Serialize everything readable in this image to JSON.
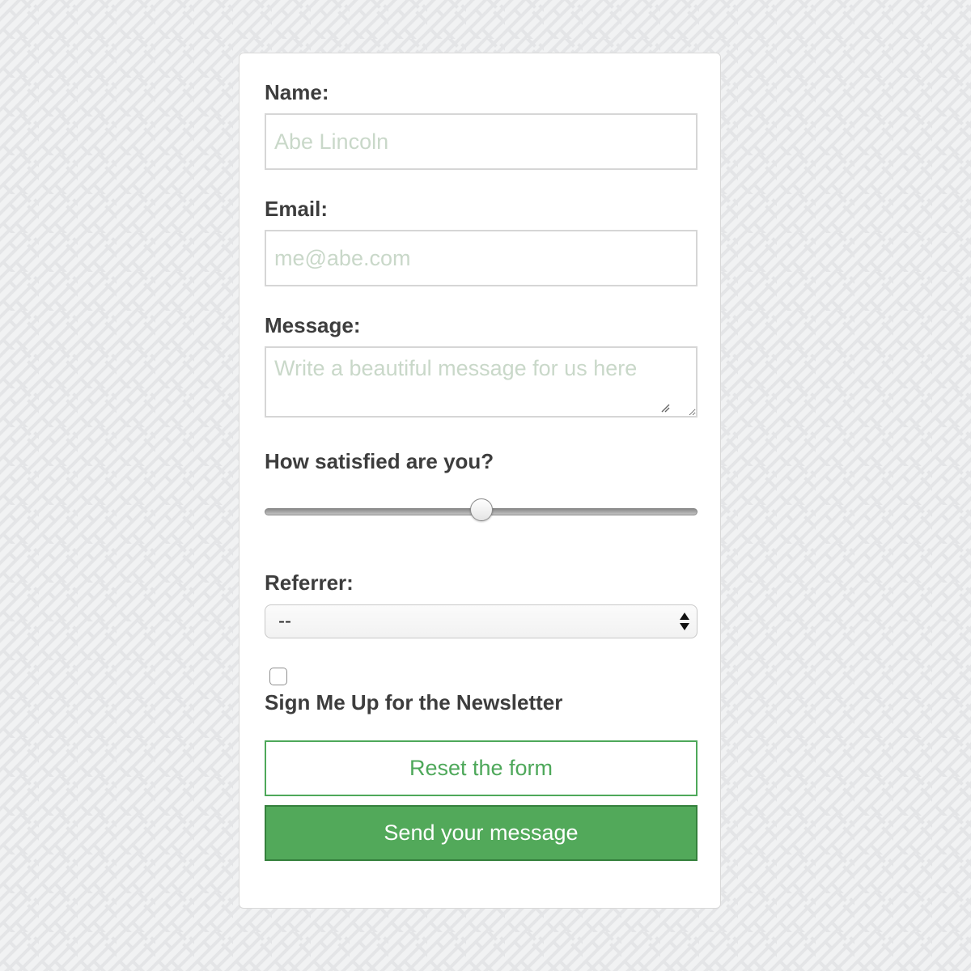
{
  "form": {
    "name_label": "Name:",
    "name_placeholder": "Abe Lincoln",
    "name_value": "",
    "email_label": "Email:",
    "email_placeholder": "me@abe.com",
    "email_value": "",
    "message_label": "Message:",
    "message_placeholder": "Write a beautiful message for us here",
    "message_value": "",
    "satisfaction_label": "How satisfied are you?",
    "satisfaction_value": 0.5,
    "referrer_label": "Referrer:",
    "referrer_selected": "--",
    "newsletter_checked": false,
    "newsletter_label": "Sign Me Up for the Newsletter",
    "reset_label": "Reset the form",
    "send_label": "Send your message"
  },
  "colors": {
    "accent": "#52a95a",
    "accent_border": "#34803c",
    "label_text": "#3d3d3d",
    "placeholder_text": "#c9d8c9",
    "background": "#f1f2f3"
  },
  "icons": {
    "select_arrows": "up-down-arrows-icon",
    "resize_grip": "resize-grip-icon"
  }
}
